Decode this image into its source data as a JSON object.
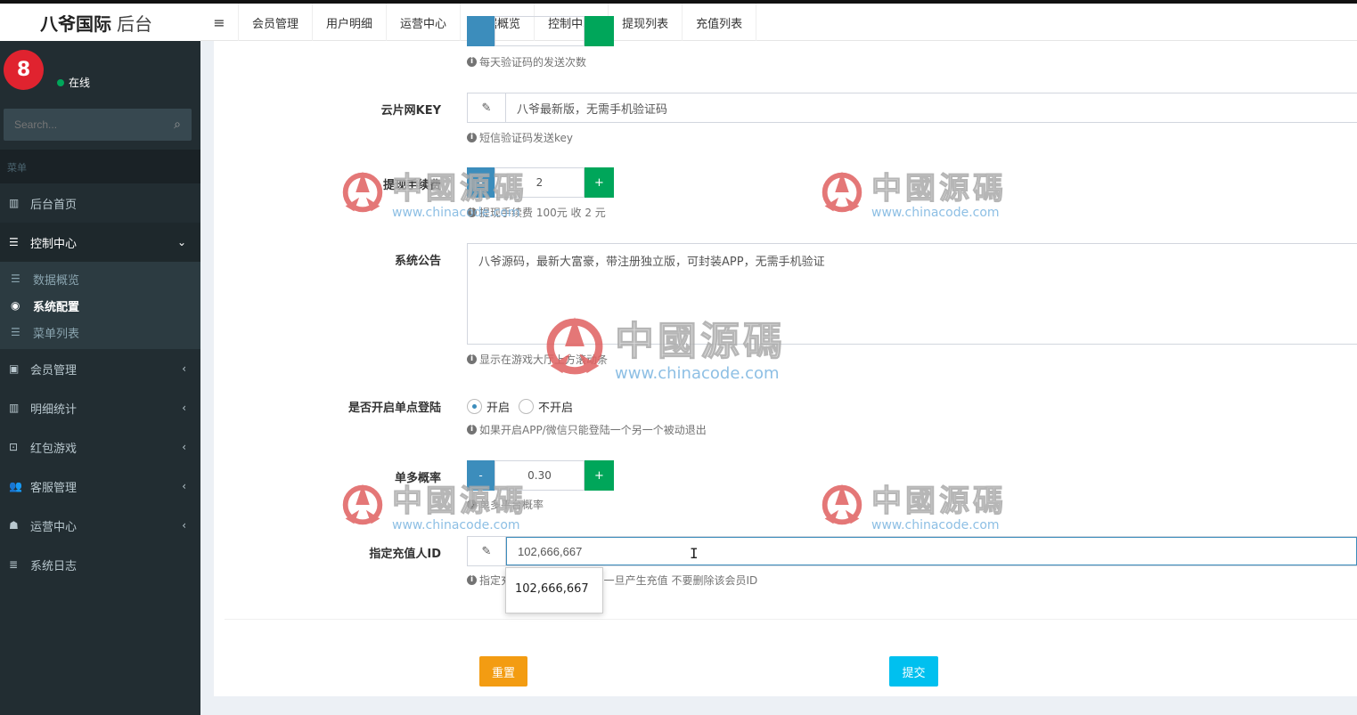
{
  "brand": {
    "bold": "八爷国际",
    "light": "后台"
  },
  "navbar": {
    "items": [
      "会员管理",
      "用户明细",
      "运营中心",
      "数据概览",
      "控制中心",
      "提现列表",
      "充值列表"
    ]
  },
  "sidebar": {
    "status": "在线",
    "search_placeholder": "Search...",
    "menu_header": "菜单",
    "items": [
      {
        "label": "后台首页"
      },
      {
        "label": "控制中心"
      },
      {
        "label": "会员管理"
      },
      {
        "label": "明细统计"
      },
      {
        "label": "红包游戏"
      },
      {
        "label": "客服管理"
      },
      {
        "label": "运营中心"
      },
      {
        "label": "系统日志"
      }
    ],
    "submenu": [
      "数据概览",
      "系统配置",
      "菜单列表"
    ]
  },
  "form": {
    "sms_help": "每天验证码的发送次数",
    "yunpian": {
      "label": "云片网KEY",
      "value": "八爷最新版，无需手机验证码",
      "help": "短信验证码发送key"
    },
    "withdraw_fee": {
      "label": "提现手续费",
      "value": "2",
      "help": "提现手续费 100元 收 2 元"
    },
    "notice": {
      "label": "系统公告",
      "value": "八爷源码，最新大富豪，带注册独立版，可封装APP，无需手机验证",
      "help": "显示在游戏大厅上方滚动条"
    },
    "sso": {
      "label": "是否开启单点登陆",
      "opt_on": "开启",
      "opt_off": "不开启",
      "help": "如果开启APP/微信只能登陆一个另一个被动退出"
    },
    "odds": {
      "label": "单多概率",
      "value": "0.30",
      "minus": "-",
      "plus": "+",
      "help": "单多平台概率"
    },
    "recharge_id": {
      "label": "指定充值人ID",
      "value": "102,666,667",
      "help": "指定充值 多个用逗号隔开 一旦产生充值 不要删除该会员ID",
      "help_prefix": "指定",
      "suggestion": "102,666,667"
    }
  },
  "buttons": {
    "reset": "重置",
    "submit": "提交"
  },
  "watermark": {
    "cn": "中國源碼",
    "url": "www.chinacode.com"
  },
  "colors": {
    "sidebar": "#222d32",
    "primary": "#3c8dbc",
    "success": "#00a65a",
    "warning": "#f39c12",
    "info": "#00c0ef"
  }
}
